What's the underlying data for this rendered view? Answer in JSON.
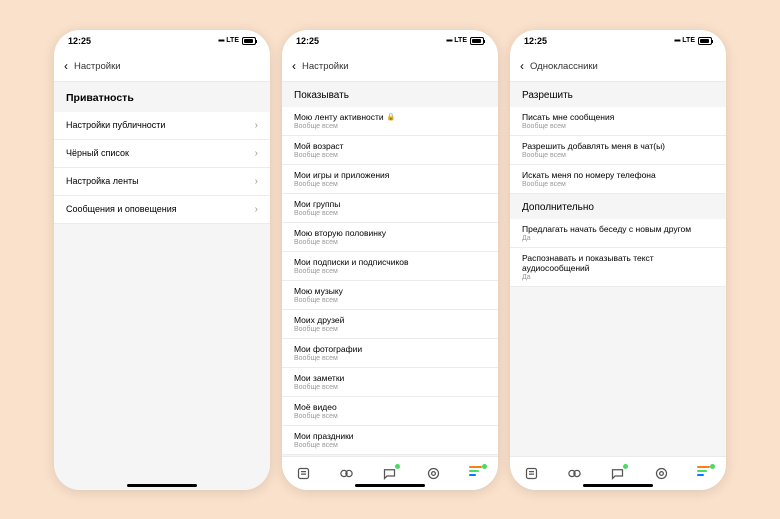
{
  "status": {
    "time": "12:25",
    "network": "LTE",
    "battery": "80"
  },
  "phone1": {
    "back": "Настройки",
    "header": "Приватность",
    "rows": [
      {
        "label": "Настройки публичности"
      },
      {
        "label": "Чёрный список"
      },
      {
        "label": "Настройка ленты"
      },
      {
        "label": "Сообщения и оповещения"
      }
    ]
  },
  "phone2": {
    "back": "Настройки",
    "header": "Показывать",
    "rows": [
      {
        "label": "Мою ленту активности",
        "sub": "Вообще всем",
        "lock": true
      },
      {
        "label": "Мой возраст",
        "sub": "Вообще всем"
      },
      {
        "label": "Мои игры и приложения",
        "sub": "Вообще всем"
      },
      {
        "label": "Мои группы",
        "sub": "Вообще всем"
      },
      {
        "label": "Мою вторую половинку",
        "sub": "Вообще всем"
      },
      {
        "label": "Мои подписки и подписчиков",
        "sub": "Вообще всем"
      },
      {
        "label": "Мою музыку",
        "sub": "Вообще всем"
      },
      {
        "label": "Моих друзей",
        "sub": "Вообще всем"
      },
      {
        "label": "Мои фотографии",
        "sub": "Вообще всем"
      },
      {
        "label": "Мои заметки",
        "sub": "Вообще всем"
      },
      {
        "label": "Моё видео",
        "sub": "Вообще всем"
      },
      {
        "label": "Мои праздники",
        "sub": "Вообще всем"
      }
    ]
  },
  "phone3": {
    "back": "Одноклассники",
    "header1": "Разрешить",
    "rows1": [
      {
        "label": "Писать мне сообщения",
        "sub": "Вообще всем"
      },
      {
        "label": "Разрешить добавлять меня в чат(ы)",
        "sub": "Вообще всем"
      },
      {
        "label": "Искать меня по номеру телефона",
        "sub": "Вообще всем"
      }
    ],
    "header2": "Дополнительно",
    "rows2": [
      {
        "label": "Предлагать начать беседу с новым другом",
        "sub": "Да"
      },
      {
        "label": "Распознавать и показывать текст аудиосообщений",
        "sub": "Да"
      }
    ]
  }
}
